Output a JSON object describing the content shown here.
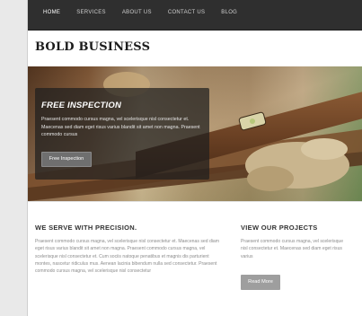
{
  "nav": {
    "items": [
      "HOME",
      "SERVICES",
      "ABOUT US",
      "CONTACT US",
      "BLOG"
    ],
    "active_index": 0
  },
  "brand": {
    "name": "BOLD BUSINESS"
  },
  "hero": {
    "title": "FREE INSPECTION",
    "text": "Praesent commodo cursus magna, vel scelerisque nisl consectetur et. Maecenas sed diam eget risus varius blandit sit amet non magna. Praesent commodo cursus",
    "button_label": "Free Inspection"
  },
  "precision": {
    "heading": "WE SERVE WITH PRECISION.",
    "text": "Praesent commodo cursus magna, vel scelerisque nisl consectetur et. Maecenas sed diam eget risus varius blandit sit amet non magna. Praesent commodo cursus magna, vel scelerisque nisl consectetur et. Cum sociis natoque penatibus et magnis dis parturient montes, nascetur ridiculus mus. Aenean lacinia bibendum nulla sed consectetur. Praesent commodo cursus magna, vel scelerisque nisl consectetur"
  },
  "projects": {
    "heading": "VIEW OUR PROJECTS",
    "text": "Praesent commodo cursus magna, vel scelerisque nisl consectetur et. Maecenas sed diam eget risus varius",
    "button_label": "Read More"
  },
  "colors": {
    "nav_bg": "#2f2f2f",
    "overlay_bg": "#1e1e1e",
    "button_bg": "#6f6f6f",
    "read_more_bg": "#9e9e9e"
  }
}
